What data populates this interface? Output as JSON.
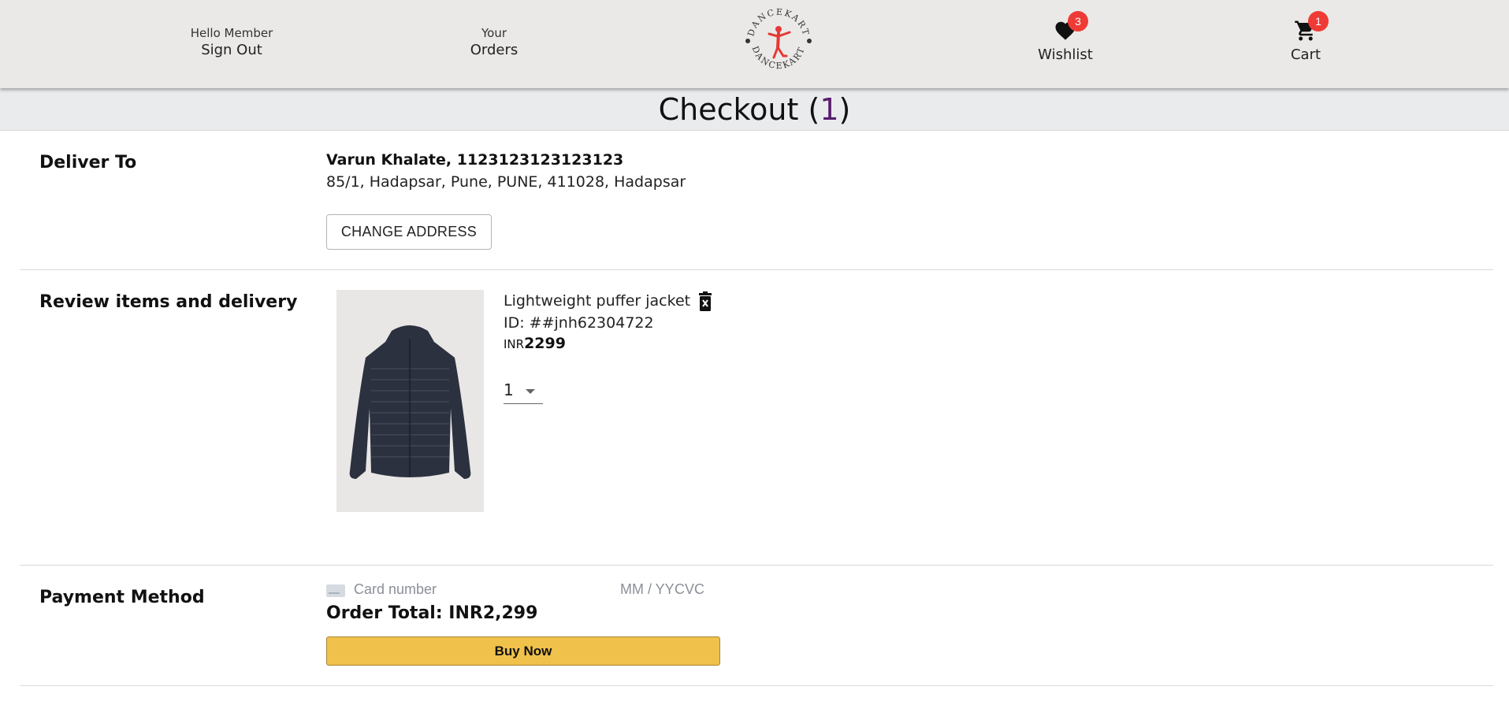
{
  "header": {
    "user_greeting": "Hello Member",
    "sign_out_label": "Sign Out",
    "orders_small": "Your",
    "orders_label": "Orders",
    "logo_text_top": "DANCEKART",
    "logo_text_bottom": "DANCEKART",
    "wishlist_label": "Wishlist",
    "wishlist_count": "3",
    "cart_label": "Cart",
    "cart_count": "1",
    "icons": [
      "heart-icon",
      "cart-icon"
    ],
    "logo_color": "#e53935"
  },
  "page": {
    "title": "Checkout",
    "title_open": " (",
    "item_count": "1",
    "title_close": ")"
  },
  "deliver": {
    "label": "Deliver To",
    "name_line": "Varun Khalate, 1123123123123123",
    "address_line": "85/1, Hadapsar, Pune, PUNE, 411028, Hadapsar",
    "change_button": "CHANGE ADDRESS"
  },
  "review": {
    "label": "Review items and delivery",
    "item": {
      "name": "Lightweight puffer jacket",
      "id_text": "ID: ##jnh62304722",
      "currency": "INR",
      "price": "2299",
      "quantity": "1",
      "image": "navy-puffer-jacket"
    },
    "delete_icon": "trash-icon"
  },
  "payment": {
    "label": "Payment Method",
    "card_placeholder": "Card number",
    "expiry_placeholder": "MM / YY",
    "cvc_placeholder": "CVC",
    "order_total": "Order Total: INR2,299",
    "buy_button": "Buy Now",
    "buy_button_color": "#f0c14b"
  }
}
